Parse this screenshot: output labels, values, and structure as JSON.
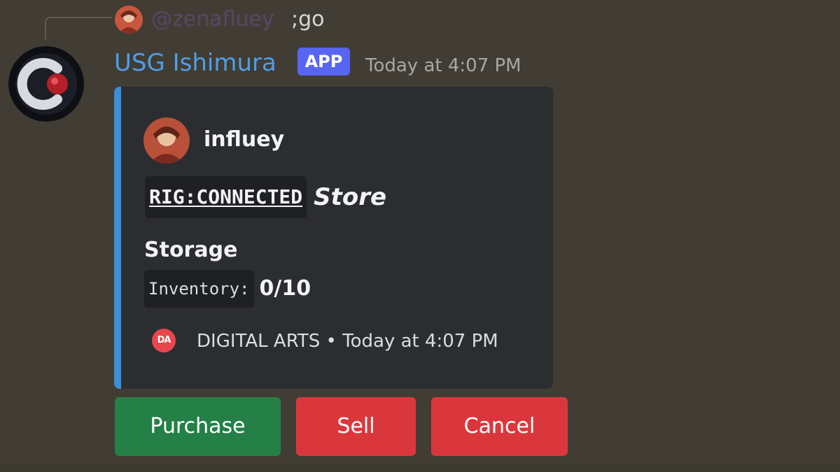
{
  "reply": {
    "mention": "@zenafluey",
    "text": ";go",
    "avatar_icon": "user-avatar-icon"
  },
  "message": {
    "author": "USG Ishimura",
    "badge": "APP",
    "timestamp": "Today at 4:07 PM",
    "avatar_icon": "bot-avatar-icon"
  },
  "embed": {
    "accent_color": "#3a8fd8",
    "author_name": "influey",
    "title_code": "RIG:CONNECTED",
    "title_suffix": "Store",
    "field": {
      "name": "Storage",
      "label": "Inventory:",
      "value": "0/10"
    },
    "footer": {
      "icon_text": "DA",
      "text": "DIGITAL ARTS • Today at 4:07 PM"
    }
  },
  "buttons": {
    "purchase": "Purchase",
    "sell": "Sell",
    "cancel": "Cancel"
  },
  "colors": {
    "success": "#248046",
    "danger": "#da373c",
    "badge": "#5865f2",
    "username": "#4f9ee8"
  }
}
